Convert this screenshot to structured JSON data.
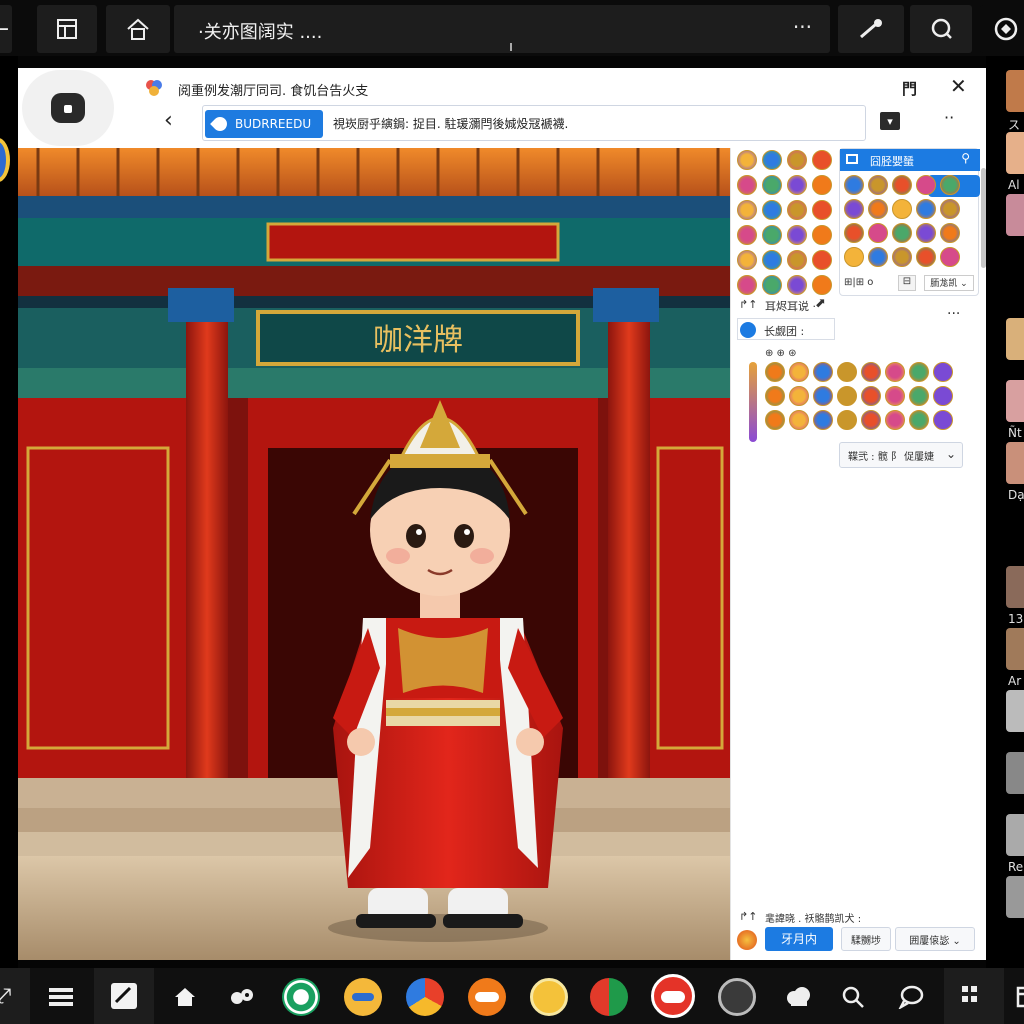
{
  "topbar": {
    "back_icon": "arrow-left",
    "title": "·关亦图阔实 ....",
    "more_label": "···",
    "icons": [
      "grid-icon",
      "home-icon",
      "wand-icon",
      "chat-search-icon",
      "globe-icon"
    ]
  },
  "window": {
    "title": "阅重例发潮厅同司. 食饥台告火支",
    "tool_label": "門",
    "close_label": "✕",
    "back_label": "‹",
    "address_chip": "BUDRREEDU",
    "address_text": "視崁厨乎縯鋦: 捉目. 駐瑗瀰閂後娍炈冦褫襪.",
    "dropdown_label": "▾",
    "more_label": "··"
  },
  "scene": {
    "plaque_text": "咖洋牌"
  },
  "panel": {
    "mini_title": "囧胫嬰蜑",
    "mini_search": "⚲",
    "mini_btn": "⧉",
    "mini_foot_left": "⊞|⊞ o",
    "mini_foot_mid": "⊟",
    "mini_foot_right": "胹尨凯 ⌄",
    "row1_icon": "↱↑",
    "row1_text": "⽿烬⽿说 ·",
    "row1_right": "⬈",
    "row1_more": "···",
    "row2_text": "⻓觑团 :",
    "row3_text": "⊕ ⊕ ⊛",
    "dropdown_text": "鞢弐 : 髋 阝 促屢婕",
    "dropdown_caret": "⌄",
    "footer_text": "靟諱晓 . 祅骼鹊凯犬 :",
    "footer_btn": "牙月内",
    "footer_pill1": "騥嬲埗",
    "footer_pill2": "囲屢偯毖 ⌄"
  },
  "rail": {
    "labels": [
      "ス",
      "Al",
      "",
      "",
      "",
      "Ñt",
      "Dạ",
      "",
      "13",
      "Ar",
      "",
      "",
      "Re",
      ""
    ]
  },
  "dock": {
    "icons": [
      "share-icon",
      "menu-icon",
      "pen-icon",
      "home-icon",
      "bird-icon",
      "target-icon",
      "burger-icon",
      "chrome-icon",
      "face-icon",
      "emoji-icon",
      "globe-icon",
      "chat-bubble-icon",
      "cat-icon",
      "cloud-icon",
      "search-icon",
      "speech-icon",
      "apps-icon",
      "window-icon"
    ]
  },
  "colors": {
    "accent": "#1c7be2",
    "window_bg": "#ffffff",
    "chrome_bg": "#0b0b0b",
    "temple_red": "#b3150f",
    "gold": "#d4a83a"
  }
}
